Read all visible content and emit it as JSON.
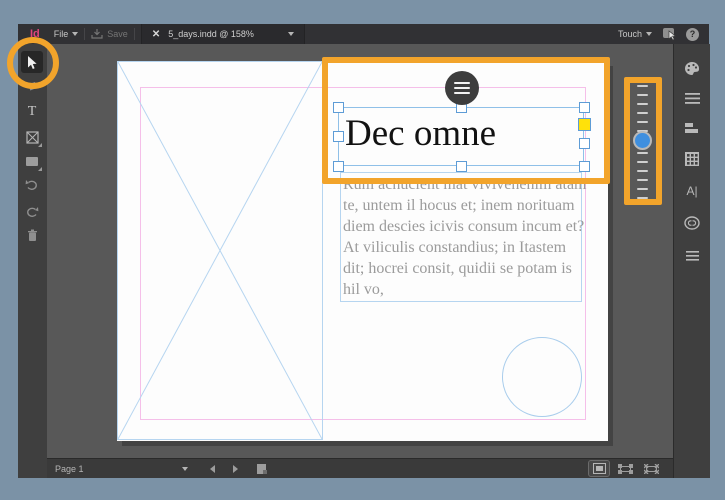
{
  "titlebar": {
    "logo": "Id",
    "file_label": "File",
    "save_label": "Save",
    "close_glyph": "✕",
    "document_title": "5_days.indd @ 158%",
    "workspace_label": "Touch",
    "help_glyph": "?"
  },
  "left_toolbar": {
    "type_tool_label": "T",
    "tools": [
      "selection-tool",
      "page-tool",
      "type-tool",
      "frame-tool",
      "rectangle-tool",
      "undo",
      "redo",
      "delete"
    ]
  },
  "right_panel": {
    "character_label": "A|",
    "icons": [
      "color-panel",
      "properties-panel",
      "align-panel",
      "swatches-panel",
      "character-panel",
      "creative-cloud",
      "panel-menu"
    ]
  },
  "document": {
    "heading": "Dec omne",
    "body_lines": [
      "Rum achucient mat vivivenenim atam",
      "te, untem il hocus et; inem norituam",
      "diem descies icivis consum incum et?",
      "At viliculis constandius; in Itastem",
      "dit; hocrei consit, quidii se potam is",
      "hil vo,"
    ]
  },
  "statusbar": {
    "page_label": "Page 1"
  },
  "zoom_slider": {
    "ticks_above": 6,
    "ticks_below": 6
  },
  "colors": {
    "highlight_orange": "#F2A42B",
    "knob_blue": "#3F8FDF",
    "selection_blue": "#5E9CD6",
    "margin_pink": "#F5BFE9",
    "guide_blue": "#AACDEC",
    "logo_magenta": "#E0447C",
    "handle_yellow": "#FFE10A"
  }
}
